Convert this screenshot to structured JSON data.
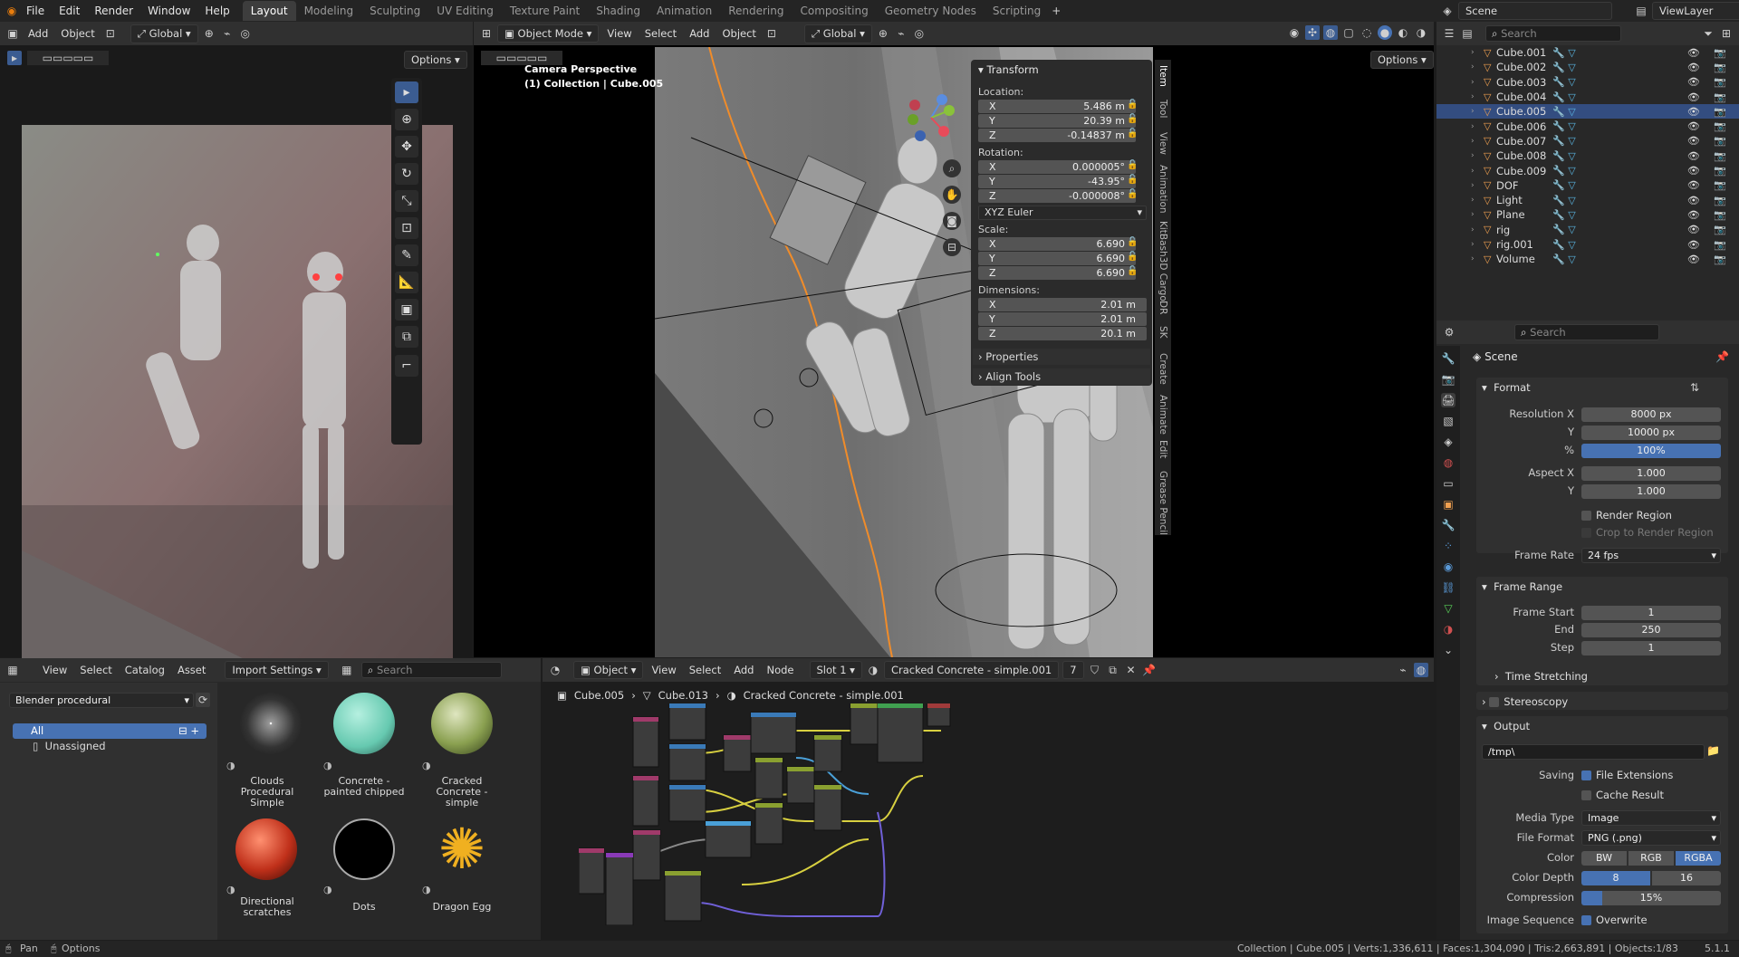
{
  "menu": {
    "items": [
      "File",
      "Edit",
      "Render",
      "Window",
      "Help"
    ]
  },
  "workspaces": [
    "Layout",
    "Modeling",
    "Sculpting",
    "UV Editing",
    "Texture Paint",
    "Shading",
    "Animation",
    "Rendering",
    "Compositing",
    "Geometry Nodes",
    "Scripting"
  ],
  "active_workspace": "Layout",
  "topbar_right": {
    "scene": "Scene",
    "viewlayer": "ViewLayer",
    "search_placeholder": "Search"
  },
  "image_editor": {
    "add": "Add",
    "object": "Object",
    "orientation": "Global",
    "options": "Options"
  },
  "viewport": {
    "mode": "Object Mode",
    "view": "View",
    "select": "Select",
    "add": "Add",
    "object": "Object",
    "orientation": "Global",
    "options": "Options",
    "overlay_title": "Camera Perspective",
    "overlay_sub": "(1) Collection | Cube.005"
  },
  "n_panel": {
    "transform": "Transform",
    "location_label": "Location:",
    "location": [
      {
        "ax": "X",
        "v": "5.486 m"
      },
      {
        "ax": "Y",
        "v": "20.39 m"
      },
      {
        "ax": "Z",
        "v": "-0.14837 m"
      }
    ],
    "rotation_label": "Rotation:",
    "rotation": [
      {
        "ax": "X",
        "v": "0.000005°"
      },
      {
        "ax": "Y",
        "v": "-43.95°"
      },
      {
        "ax": "Z",
        "v": "-0.000008°"
      }
    ],
    "rotation_mode": "XYZ Euler",
    "scale_label": "Scale:",
    "scale": [
      {
        "ax": "X",
        "v": "6.690"
      },
      {
        "ax": "Y",
        "v": "6.690"
      },
      {
        "ax": "Z",
        "v": "6.690"
      }
    ],
    "dimensions_label": "Dimensions:",
    "dimensions": [
      {
        "ax": "X",
        "v": "2.01 m"
      },
      {
        "ax": "Y",
        "v": "2.01 m"
      },
      {
        "ax": "Z",
        "v": "20.1 m"
      }
    ],
    "properties": "Properties",
    "align_tools": "Align Tools",
    "tabs": [
      "Item",
      "Tool",
      "View",
      "Animation",
      "KitBash3D Cargo",
      "DR",
      "SK",
      "Create",
      "Animate",
      "Edit",
      "Grease Pencil"
    ]
  },
  "outliner": {
    "items": [
      {
        "name": "Cube.001",
        "sel": false
      },
      {
        "name": "Cube.002",
        "sel": false
      },
      {
        "name": "Cube.003",
        "sel": false
      },
      {
        "name": "Cube.004",
        "sel": false
      },
      {
        "name": "Cube.005",
        "sel": true
      },
      {
        "name": "Cube.006",
        "sel": false
      },
      {
        "name": "Cube.007",
        "sel": false
      },
      {
        "name": "Cube.008",
        "sel": false
      },
      {
        "name": "Cube.009",
        "sel": false
      },
      {
        "name": "DOF",
        "sel": false
      },
      {
        "name": "Light",
        "sel": false
      },
      {
        "name": "Plane",
        "sel": false
      },
      {
        "name": "rig",
        "sel": false
      },
      {
        "name": "rig.001",
        "sel": false
      },
      {
        "name": "Volume",
        "sel": false
      }
    ]
  },
  "properties": {
    "search_placeholder": "Search",
    "scene": "Scene",
    "format": "Format",
    "resolution_x_label": "Resolution X",
    "resolution_x": "8000 px",
    "y_label": "Y",
    "resolution_y": "10000 px",
    "pct_label": "%",
    "pct": "100%",
    "aspect_x_label": "Aspect X",
    "aspect_x": "1.000",
    "aspect_y_label": "Y",
    "aspect_y": "1.000",
    "render_region": "Render Region",
    "crop_region": "Crop to Render Region",
    "frame_rate_label": "Frame Rate",
    "frame_rate": "24 fps",
    "frame_range": "Frame Range",
    "frame_start_label": "Frame Start",
    "frame_start": "1",
    "end_label": "End",
    "end": "250",
    "step_label": "Step",
    "step": "1",
    "time_stretching": "Time Stretching",
    "stereoscopy": "Stereoscopy",
    "output": "Output",
    "path": "/tmp\\",
    "saving_label": "Saving",
    "file_ext": "File Extensions",
    "cache_result": "Cache Result",
    "media_type_label": "Media Type",
    "media_type": "Image",
    "file_format_label": "File Format",
    "file_format": "PNG (.png)",
    "color_label": "Color",
    "color_opts": [
      "BW",
      "RGB",
      "RGBA"
    ],
    "color_depth_label": "Color Depth",
    "depth_opts": [
      "8",
      "16"
    ],
    "compression_label": "Compression",
    "compression": "15%",
    "image_seq_label": "Image Sequence",
    "overwrite": "Overwrite"
  },
  "asset_browser": {
    "view": "View",
    "select": "Select",
    "catalog": "Catalog",
    "asset": "Asset",
    "import_settings": "Import Settings",
    "search_placeholder": "Search",
    "library": "Blender procedural",
    "catalog_all": "All",
    "catalog_unassigned": "Unassigned",
    "assets": [
      {
        "l1": "Clouds",
        "l2": "Procedural Simple"
      },
      {
        "l1": "Concrete -",
        "l2": "painted chipped"
      },
      {
        "l1": "Cracked",
        "l2": "Concrete - simple"
      },
      {
        "l1": "Directional",
        "l2": "scratches"
      },
      {
        "l1": "Dots",
        "l2": ""
      },
      {
        "l1": "Dragon Egg",
        "l2": ""
      }
    ]
  },
  "node_editor": {
    "object": "Object",
    "view": "View",
    "select": "Select",
    "add": "Add",
    "node": "Node",
    "slot": "Slot 1",
    "material": "Cracked Concrete - simple.001",
    "users": "7",
    "bc_object": "Cube.005",
    "bc_mesh": "Cube.013",
    "bc_mat": "Cracked Concrete - simple.001"
  },
  "statusbar": {
    "pan": "Pan",
    "options": "Options",
    "stats": "Collection | Cube.005 | Verts:1,336,611 | Faces:1,304,090 | Tris:2,663,891 | Objects:1/83",
    "version": "5.1.1"
  },
  "colors": {
    "accent": "#4772b3",
    "selected_row": "#334d80",
    "orange_outline": "#f08c2a"
  }
}
